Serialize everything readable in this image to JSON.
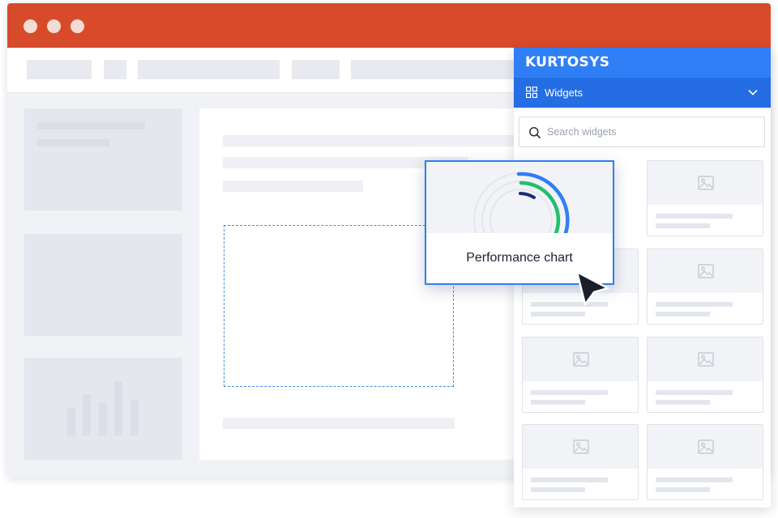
{
  "window": {
    "titlebar_color": "#d74b2b",
    "controls": [
      "window-dot-1",
      "window-dot-2",
      "window-dot-3"
    ]
  },
  "widget_panel": {
    "brand": "KURTOSYS",
    "tab": {
      "label": "Widgets",
      "icon": "grid-icon",
      "expand_icon": "chevron-down-icon"
    },
    "search": {
      "placeholder": "Search widgets",
      "value": "",
      "icon": "search-icon"
    },
    "accent_color": "#2f7ef5",
    "widget_card_icon": "image-icon"
  },
  "dragged_widget": {
    "label": "Performance chart",
    "ring_colors": [
      "#2f7ef5",
      "#1fbf6e",
      "#1b2a7a"
    ]
  },
  "cursor_icon": "cursor-arrow-icon"
}
